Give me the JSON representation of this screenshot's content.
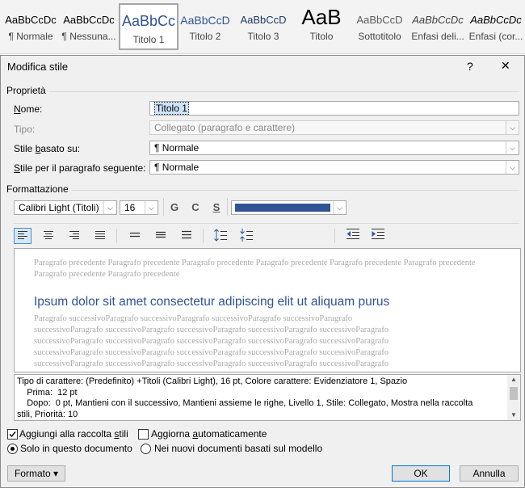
{
  "gallery": [
    {
      "preview": "AaBbCcDc",
      "label": "¶ Normale"
    },
    {
      "preview": "AaBbCcDc",
      "label": "¶ Nessuna..."
    },
    {
      "preview": "AaBbCc",
      "label": "Titolo 1"
    },
    {
      "preview": "AaBbCcD",
      "label": "Titolo 2"
    },
    {
      "preview": "AaBbCcD",
      "label": "Titolo 3"
    },
    {
      "preview": "AaB",
      "label": "Titolo"
    },
    {
      "preview": "AaBbCcD",
      "label": "Sottotitolo"
    },
    {
      "preview": "AaBbCcDc",
      "label": "Enfasi deli..."
    },
    {
      "preview": "AaBbCcDc",
      "label": "Enfasi (cor..."
    }
  ],
  "dialog": {
    "title": "Modifica stile",
    "help": "?",
    "close": "✕",
    "section_properties": "Proprietà",
    "name_label": "Nome:",
    "name_value": "Titolo 1",
    "type_label": "Tipo:",
    "type_value": "Collegato (paragrafo e carattere)",
    "based_label": "Stile basato su:",
    "based_value": "¶  Normale",
    "next_label": "Stile per il paragrafo seguente:",
    "next_value": "¶  Normale",
    "section_format": "Formattazione",
    "font": "Calibri Light (Titoli)",
    "size": "16",
    "bold": "G",
    "italic": "C",
    "underline": "S",
    "font_color": "#2e5496",
    "preview_prev": "Paragrafo precedente Paragrafo precedente Paragrafo precedente Paragrafo precedente Paragrafo precedente Paragrafo precedente Paragrafo precedente Paragrafo precedente",
    "preview_heading": "Ipsum dolor sit amet consectetur adipiscing elit ut aliquam purus",
    "preview_next": [
      "Paragrafo successivoParagrafo successivoParagrafo successivoParagrafo successivoParagrafo",
      "successivoParagrafo successivoParagrafo successivoParagrafo successivoParagrafo successivoParagrafo",
      "successivoParagrafo successivoParagrafo successivoParagrafo successivoParagrafo successivoParagrafo",
      "successivoParagrafo successivoParagrafo successivoParagrafo successivoParagrafo successivoParagrafo",
      "successivoParagrafo successivoParagrafo successivoParagrafo successivoParagrafo successivoParagrafo"
    ],
    "description": [
      "Tipo di carattere: (Predefinito) +Titoli (Calibri Light), 16 pt, Colore carattere: Evidenziatore 1, Spazio",
      "    Prima:  12 pt",
      "    Dopo:  0 pt, Mantieni con il successivo, Mantieni assieme le righe, Livello 1, Stile: Collegato, Mostra nella raccolta",
      "stili, Priorità: 10"
    ],
    "add_gallery": "Aggiungi alla raccolta stili",
    "auto_update": "Aggiorna automaticamente",
    "only_doc": "Solo in questo documento",
    "new_docs": "Nei nuovi documenti basati sul modello",
    "format_btn": "Formato ▾",
    "ok": "OK",
    "cancel": "Annulla"
  }
}
